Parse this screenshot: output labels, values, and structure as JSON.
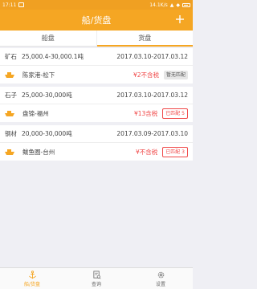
{
  "status_bar": {
    "time": "17:11",
    "speed": "14.1K/s"
  },
  "header": {
    "title": "船/货盘"
  },
  "tabs": [
    {
      "label": "船盘",
      "active": false
    },
    {
      "label": "货盘",
      "active": true
    }
  ],
  "cards": [
    {
      "cargo": "矿石",
      "quantity": "25,000.4-30,000.1吨",
      "dates": "2017.03.10-2017.03.12",
      "route": "陈家港-松下",
      "price": "¥2不含税",
      "badge": "暂无匹配",
      "badge_style": "gray"
    },
    {
      "cargo": "石子",
      "quantity": "25,000-30,000吨",
      "dates": "2017.03.10-2017.03.12",
      "route": "盘锦-福州",
      "price": "¥13含税",
      "badge": "已匹配 5",
      "badge_style": "red"
    },
    {
      "cargo": "钢材",
      "quantity": "20,000-30,000吨",
      "dates": "2017.03.09-2017.03.10",
      "route": "鲅鱼圈-台州",
      "price": "¥不含税",
      "badge": "已匹配 3",
      "badge_style": "red"
    }
  ],
  "bottom_nav": [
    {
      "label": "船/货盘",
      "icon": "anchor-icon",
      "active": true
    },
    {
      "label": "查询",
      "icon": "document-search-icon",
      "active": false
    },
    {
      "label": "设置",
      "icon": "gear-icon",
      "active": false
    }
  ],
  "colors": {
    "accent": "#f5a623",
    "price_red": "#f04848",
    "background": "#efeff4"
  }
}
